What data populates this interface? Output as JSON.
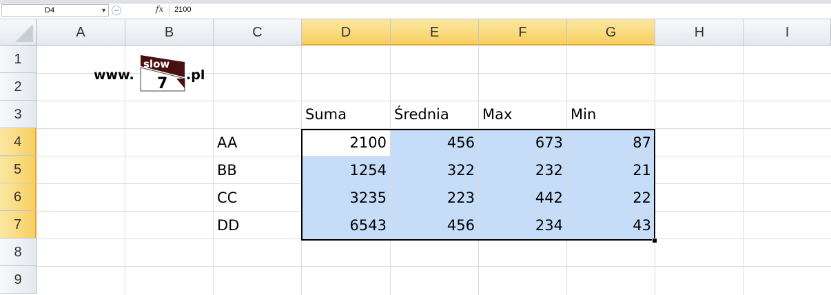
{
  "formula_bar": {
    "name_box": "D4",
    "fx_label": "fx",
    "formula": "2100"
  },
  "columns": [
    "A",
    "B",
    "C",
    "D",
    "E",
    "F",
    "G",
    "H",
    "I"
  ],
  "rows": [
    "1",
    "2",
    "3",
    "4",
    "5",
    "6",
    "7",
    "8",
    "9"
  ],
  "logo": {
    "prefix": "www.",
    "top_word": "slow",
    "number": "7",
    "suffix": ".pl"
  },
  "headers": {
    "d": "Suma",
    "e": "Średnia",
    "f": "Max",
    "g": "Min"
  },
  "table": [
    {
      "label": "AA",
      "d": "2100",
      "e": "456",
      "f": "673",
      "g": "87"
    },
    {
      "label": "BB",
      "d": "1254",
      "e": "322",
      "f": "232",
      "g": "21"
    },
    {
      "label": "CC",
      "d": "3235",
      "e": "223",
      "f": "442",
      "g": "22"
    },
    {
      "label": "DD",
      "d": "6543",
      "e": "456",
      "f": "234",
      "g": "43"
    }
  ],
  "colors": {
    "selection_fill": "#c5ddf8",
    "header_selected": "#f7cf5f",
    "logo_dark": "#4a0f0f"
  }
}
